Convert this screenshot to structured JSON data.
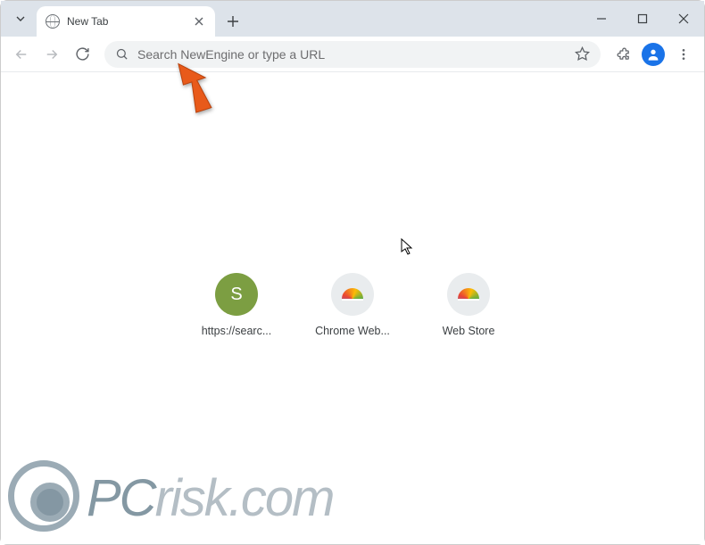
{
  "window": {
    "tab_title": "New Tab",
    "controls": {
      "minimize": "−",
      "maximize": "▢",
      "close": "✕"
    }
  },
  "toolbar": {
    "omnibox_placeholder": "Search NewEngine or type a URL"
  },
  "shortcuts": [
    {
      "label": "https://searc...",
      "icon_type": "letter",
      "letter": "S"
    },
    {
      "label": "Chrome Web...",
      "icon_type": "chrome"
    },
    {
      "label": "Web Store",
      "icon_type": "chrome"
    }
  ],
  "watermark": {
    "text_prefix": "PC",
    "text_suffix": "risk.com"
  }
}
